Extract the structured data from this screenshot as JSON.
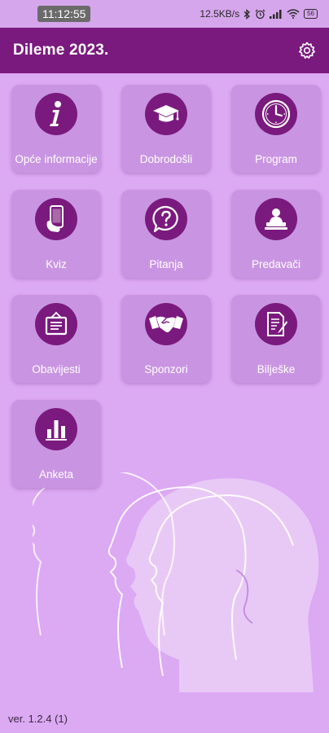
{
  "status_bar": {
    "time": "11:12:55",
    "network_speed": "12.5KB/s",
    "battery": "56",
    "icons": [
      "bluetooth-icon",
      "alarm-icon",
      "signal-icon",
      "wifi-icon",
      "battery-icon"
    ]
  },
  "app_bar": {
    "title": "Dileme 2023.",
    "settings_icon": "gear-icon"
  },
  "tiles": [
    {
      "label": "Opće informacije",
      "icon": "info-icon"
    },
    {
      "label": "Dobrodošli",
      "icon": "graduation-cap-icon"
    },
    {
      "label": "Program",
      "icon": "clock-icon"
    },
    {
      "label": "Kviz",
      "icon": "smartphone-icon"
    },
    {
      "label": "Pitanja",
      "icon": "question-bubble-icon"
    },
    {
      "label": "Predavači",
      "icon": "lecturer-icon"
    },
    {
      "label": "Obavijesti",
      "icon": "notice-board-icon"
    },
    {
      "label": "Sponzori",
      "icon": "handshake-icon"
    },
    {
      "label": "Bilješke",
      "icon": "notes-icon"
    },
    {
      "label": "Anketa",
      "icon": "bar-chart-icon"
    }
  ],
  "footer": {
    "version": "ver. 1.2.4 (1)"
  },
  "colors": {
    "primary": "#7b1a7e",
    "background": "#dca9f3",
    "tile": "#c995e2"
  }
}
